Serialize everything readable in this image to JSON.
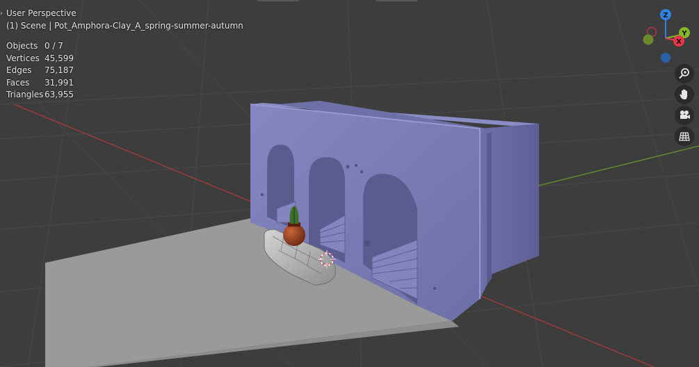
{
  "viewport": {
    "mode_label": "User Perspective",
    "scene_label": "(1) Scene | Pot_Amphora-Clay_A_spring-summer-autumn"
  },
  "stats": [
    {
      "label": "Objects",
      "value": "0 / 7"
    },
    {
      "label": "Vertices",
      "value": "45,599"
    },
    {
      "label": "Edges",
      "value": "75,187"
    },
    {
      "label": "Faces",
      "value": "31,991"
    },
    {
      "label": "Triangles",
      "value": "63,955"
    }
  ],
  "gizmo": {
    "z_label": "Z",
    "y_label": "Y",
    "x_label": "X",
    "colors": {
      "x": "#e8364a",
      "y": "#86b629",
      "z": "#2f84e3"
    }
  },
  "tools": [
    {
      "name": "zoom-icon"
    },
    {
      "name": "hand-pan-icon"
    },
    {
      "name": "camera-icon"
    },
    {
      "name": "grid-ortho-icon"
    }
  ],
  "colors": {
    "background": "#3d3d3d",
    "grid_line": "#474747",
    "axis_x": "#9b3c3c",
    "axis_y": "#5f8a2e",
    "model_clay": "#7b7cb8",
    "ground_plane": "#9a9a9a"
  }
}
